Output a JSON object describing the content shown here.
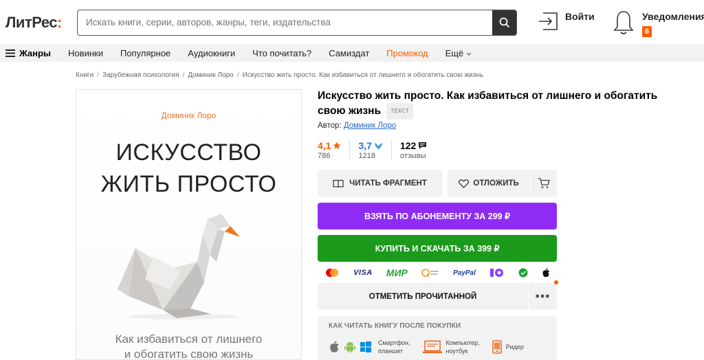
{
  "header": {
    "logo_main": "ЛитРес",
    "logo_accent": ":",
    "search_placeholder": "Искать книги, серии, авторов, жанры, теги, издательства",
    "login_label": "Войти",
    "notifications_label": "Уведомления",
    "notifications_count": "6"
  },
  "nav": {
    "genres": "Жанры",
    "items": [
      "Новинки",
      "Популярное",
      "Аудиокниги",
      "Что почитать?",
      "Самиздат"
    ],
    "promo": "Промокод",
    "more": "Ещё"
  },
  "breadcrumb": [
    "Книги",
    "Зарубежная психология",
    "Доминик Лоро",
    "Искусство жить просто. Как избавиться от лишнего и обогатить свою жизнь"
  ],
  "cover": {
    "author": "Доминик Лоро",
    "title_line1": "ИСКУССТВО",
    "title_line2": "ЖИТЬ ПРОСТО",
    "subtitle_line1": "Как избавиться от лишнего",
    "subtitle_line2": "и обогатить свою жизнь"
  },
  "book": {
    "title": "Искусство жить просто. Как избавиться от лишнего и обогатить свою жизнь",
    "tag": "ТЕКСТ",
    "author_label": "Автор:",
    "author_name": "Доминик Лоро"
  },
  "stats": {
    "litres_rating": "4,1",
    "litres_votes": "786",
    "livelib_rating": "3,7",
    "livelib_votes": "1218",
    "reviews_count": "122",
    "reviews_label": "отзывы"
  },
  "actions": {
    "read_fragment": "ЧИТАТЬ ФРАГМЕНТ",
    "defer": "ОТЛОЖИТЬ",
    "subscribe": "ВЗЯТЬ ПО АБОНЕМЕНТУ ЗА 299 ₽",
    "buy": "КУПИТЬ И СКАЧАТЬ ЗА 399 ₽",
    "mark_read": "ОТМЕТИТЬ ПРОЧИТАННОЙ",
    "more": "•••"
  },
  "payments": {
    "visa": "VISA",
    "mir": "МИР",
    "paypal": "PayPal"
  },
  "howto": {
    "title": "КАК ЧИТАТЬ КНИГУ ПОСЛЕ ПОКУПКИ",
    "smartphone_line1": "Смартфон,",
    "smartphone_line2": "планшет",
    "computer_line1": "Компьютер,",
    "computer_line2": "ноутбук",
    "reader": "Ридер"
  },
  "colors": {
    "accent": "#ff5c00",
    "subscribe": "#8f2cf4",
    "buy": "#1b9a1b",
    "link": "#2566c4"
  }
}
